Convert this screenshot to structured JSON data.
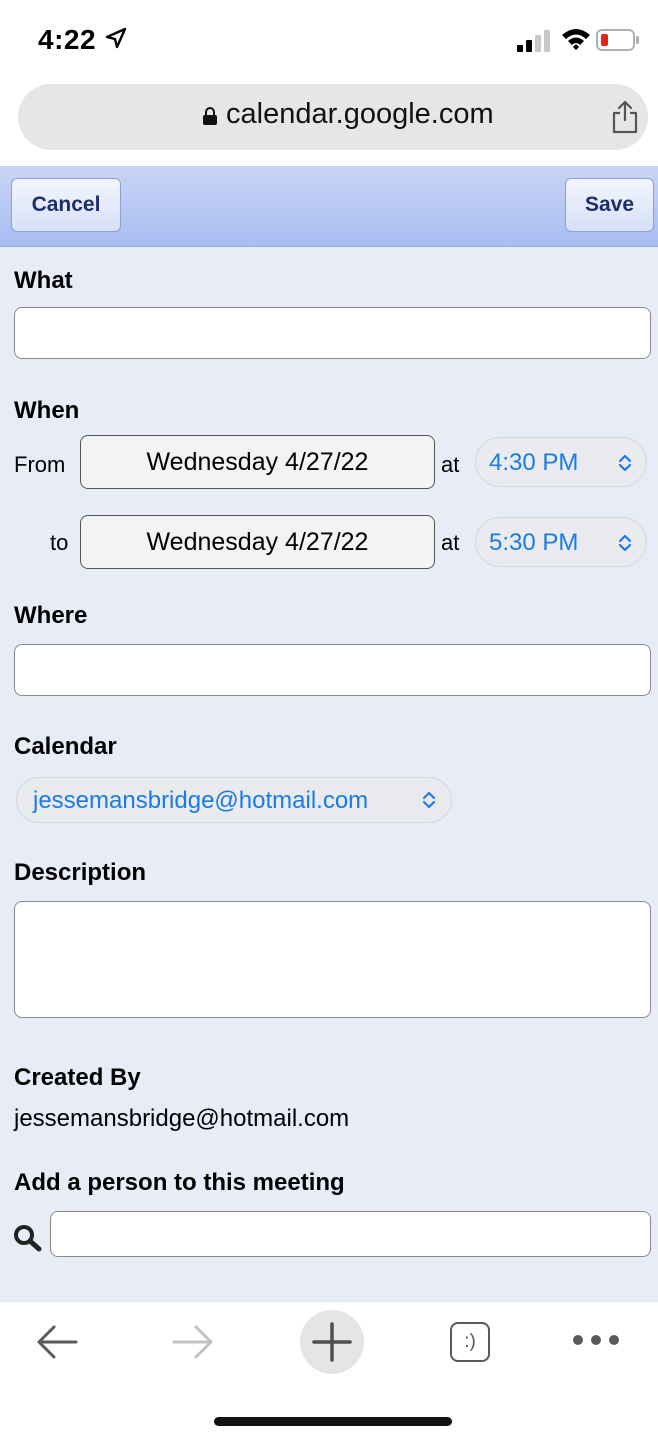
{
  "status_bar": {
    "time": "4:22"
  },
  "browser": {
    "url": "calendar.google.com"
  },
  "toolbar": {
    "cancel_label": "Cancel",
    "save_label": "Save"
  },
  "form": {
    "what_label": "What",
    "what_value": "",
    "when_label": "When",
    "from_label": "From",
    "to_label": "to",
    "at_label": "at",
    "from_date": "Wednesday 4/27/22",
    "from_time": "4:30 PM",
    "to_date": "Wednesday 4/27/22",
    "to_time": "5:30 PM",
    "where_label": "Where",
    "where_value": "",
    "calendar_label": "Calendar",
    "calendar_value": "jessemansbridge@hotmail.com",
    "description_label": "Description",
    "description_value": "",
    "created_by_label": "Created By",
    "created_by_value": "jessemansbridge@hotmail.com",
    "add_person_label": "Add a person to this meeting",
    "add_person_value": ""
  },
  "bottom_nav": {
    "tabs_icon_text": ":)"
  },
  "colors": {
    "accent_blue": "#1a7be8",
    "toolbar_top": "#c9d5f5",
    "toolbar_bottom": "#a8bcf0",
    "form_background": "#e8ecf7",
    "battery_low": "#e5251c"
  },
  "icons": [
    "location-arrow-icon",
    "signal-icon",
    "wifi-icon",
    "battery-icon",
    "lock-icon",
    "share-icon",
    "chevron-updown-icon",
    "search-icon",
    "back-arrow-icon",
    "forward-arrow-icon",
    "new-tab-plus-icon",
    "tabs-icon",
    "more-icon"
  ]
}
